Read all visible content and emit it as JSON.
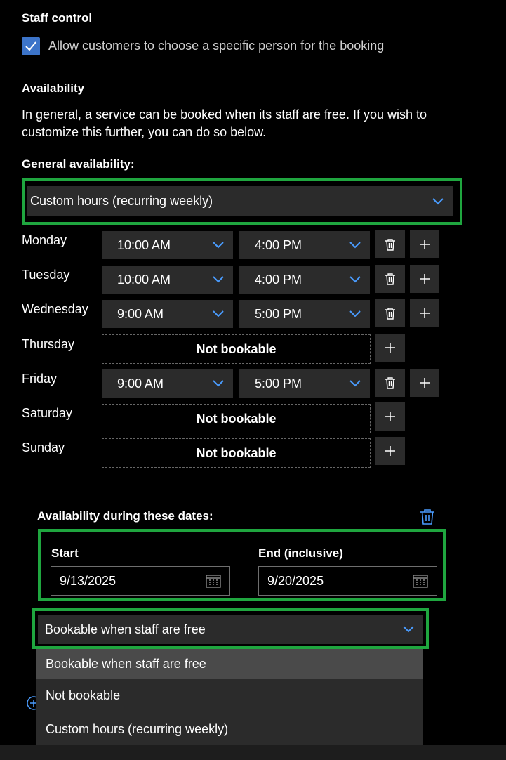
{
  "staff_control": {
    "heading": "Staff control",
    "checkbox_label": "Allow customers to choose a specific person for the booking",
    "checked": true
  },
  "availability": {
    "heading": "Availability",
    "description_line1": "In general, a service can be booked when its staff are free. If you wish to",
    "description_line2": "customize this further, you can do so below.",
    "general_label": "General availability:",
    "general_value": "Custom hours (recurring weekly)"
  },
  "days": [
    {
      "name": "Monday",
      "start": "10:00 AM",
      "end": "4:00 PM"
    },
    {
      "name": "Tuesday",
      "start": "10:00 AM",
      "end": "4:00 PM"
    },
    {
      "name": "Wednesday",
      "start": "9:00 AM",
      "end": "5:00 PM"
    },
    {
      "name": "Thursday",
      "not_bookable": "Not bookable"
    },
    {
      "name": "Friday",
      "start": "9:00 AM",
      "end": "5:00 PM"
    },
    {
      "name": "Saturday",
      "not_bookable": "Not bookable"
    },
    {
      "name": "Sunday",
      "not_bookable": "Not bookable"
    }
  ],
  "date_range": {
    "heading": "Availability during these dates:",
    "start_label": "Start",
    "start_value": "9/13/2025",
    "end_label": "End (inclusive)",
    "end_value": "9/20/2025",
    "mode_value": "Bookable when staff are free",
    "options": [
      "Bookable when staff are free",
      "Not bookable",
      "Custom hours (recurring weekly)"
    ]
  },
  "colors": {
    "accent": "#3c74c9",
    "chevron": "#4a9cff",
    "highlight": "#1fa63f"
  }
}
